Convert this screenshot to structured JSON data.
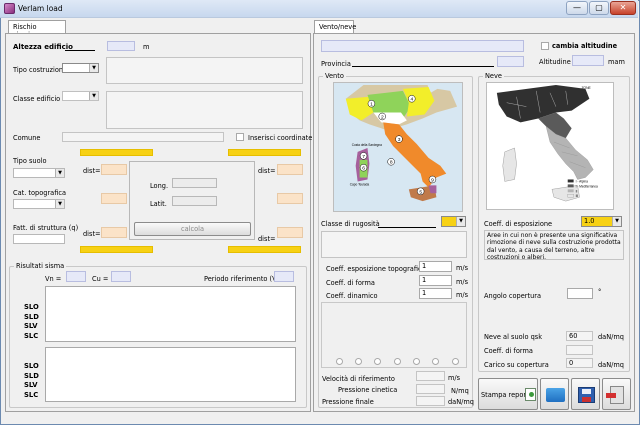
{
  "window": {
    "title": "Verlam load",
    "min": "—",
    "max": "▢",
    "close": "✕"
  },
  "tabs": {
    "left": "Rischio sismico",
    "right": "Vento/neve"
  },
  "sismico": {
    "altezza_label": "Altezza edificio",
    "altezza_unit": "m",
    "tipo_costruzione_label": "Tipo costruzione",
    "classe_edificio_label": "Classe edificio",
    "comune_label": "Comune",
    "inserisci_coord_label": "Inserisci coordinate",
    "tipo_suolo_label": "Tipo suolo",
    "cat_topografica_label": "Cat. topografica",
    "fatt_struttura_label": "Fatt. di struttura (q)",
    "dist_label": "dist=",
    "long_label": "Long.",
    "latit_label": "Latit.",
    "calcola_label": "calcola"
  },
  "risultati": {
    "group_title": "Risultati sisma",
    "vn_label": "Vn =",
    "cu_label": "Cu =",
    "periodo_label": "Periodo riferimento (Vr) =",
    "states_top": [
      "SLO",
      "SLD",
      "SLV",
      "SLC"
    ],
    "states_bottom": [
      "SLO",
      "SLD",
      "SLV",
      "SLC"
    ]
  },
  "ventoneve": {
    "cambia_altitudine_label": "cambia altitudine",
    "provincia_label": "Provincia",
    "altitudine_label": "Altitudine",
    "altitudine_unit": "mam"
  },
  "vento": {
    "group_title": "Vento",
    "zone_labels": [
      "1",
      "2",
      "3",
      "4",
      "5",
      "6",
      "7",
      "8",
      "9"
    ],
    "sardegna_label": "Costa della Sardegna",
    "capo_label": "Capo Teulada",
    "classe_rugosita_label": "Classe di rugosità",
    "coeff_esp_topo_label": "Coeff. esposizione topografica",
    "coeff_esp_topo_value": "1",
    "coeff_forma_label": "Coeff. di forma",
    "coeff_forma_value": "1",
    "coeff_dinamico_label": "Coeff. dinamico",
    "coeff_dinamico_value": "1",
    "unit_ms": "m/s",
    "velocita_label": "Velocità di riferimento",
    "pressione_cinetica_label": "Pressione cinetica",
    "pressione_cinetica_unit": "N/mq",
    "pressione_finale_label": "Pressione finale",
    "pressione_finale_unit": "daN/mq"
  },
  "neve": {
    "group_title": "Neve",
    "legend_title": "ZONE",
    "legend_items": [
      "I - Alpina",
      "I - Mediterranea",
      "II",
      "III"
    ],
    "coeff_esposizione_label": "Coeff. di esposizione",
    "coeff_esposizione_value": "1.0",
    "description": "Aree in cui non è presente una significativa rimozione di neve sulla costruzione prodotta dal vento, a causa del terreno, altre costruzioni o alberi.",
    "angolo_copertura_label": "Angolo copertura",
    "angolo_unit": "°",
    "neve_suolo_label": "Neve al suolo qsk",
    "neve_suolo_value": "60",
    "neve_unit": "daN/mq",
    "coeff_forma_label": "Coeff. di forma",
    "carico_label": "Carico su copertura",
    "carico_value": "0",
    "carico_unit": "daN/mq"
  },
  "toolbar": {
    "stampa_label": "Stampa report"
  },
  "colors": {
    "yellow": "#f7d114",
    "peach": "#fbe3c8",
    "lavender": "#e6e9f8",
    "orange_zone": "#f08a2b",
    "yellow_zone": "#f2ee2a",
    "green_zone": "#8fd35a",
    "purple_zone": "#a6609c",
    "brown_zone": "#c07a4a"
  }
}
